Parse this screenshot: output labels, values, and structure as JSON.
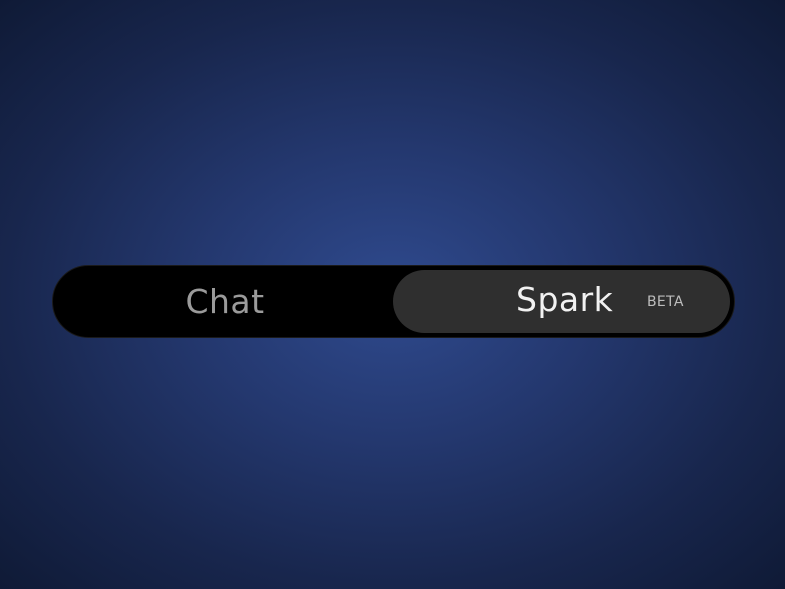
{
  "toggle": {
    "options": [
      {
        "label": "Chat",
        "selected": false
      },
      {
        "label": "Spark",
        "selected": true,
        "badge": "BETA"
      }
    ]
  },
  "colors": {
    "background_center": "#2f4a8e",
    "background_edge": "#0f1a36",
    "track": "#000000",
    "selected_pill": "#2f2f2f",
    "unselected_text": "#9b9b9b",
    "selected_text": "#f2f2f2",
    "badge_text": "#bdbdbd"
  }
}
